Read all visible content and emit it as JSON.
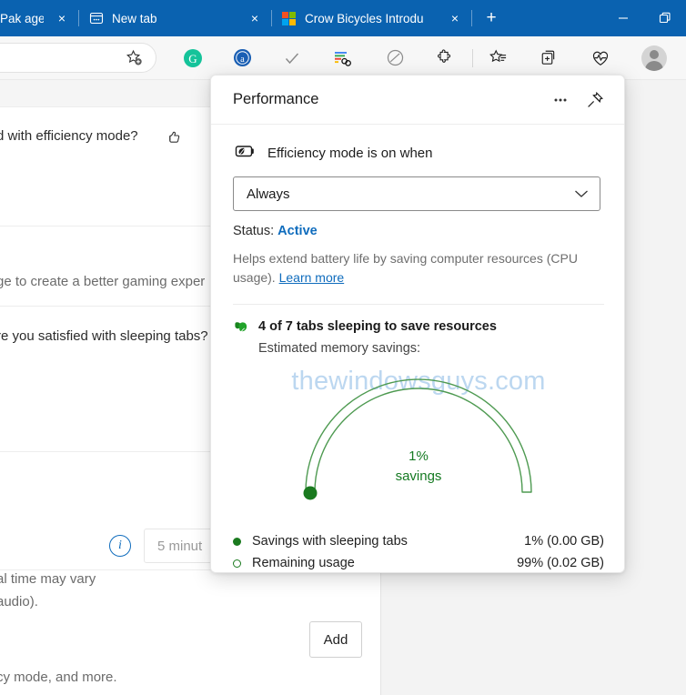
{
  "window": {
    "tabs": [
      {
        "title": "Pak agen",
        "favicon": "none",
        "close_label": "×"
      },
      {
        "title": "New tab",
        "favicon": "newtab-icon",
        "close_label": "×"
      },
      {
        "title": "Crow Bicycles Introdu",
        "favicon": "microsoft-logo",
        "close_label": "×"
      }
    ],
    "new_tab_button": "+",
    "controls": {
      "minimize": "—",
      "restore": "❐"
    }
  },
  "toolbar": {
    "icons": [
      "add-favorite-icon",
      "grammarly-icon",
      "amazon-assistant-icon",
      "checkmark-icon",
      "google-translate-link-icon",
      "adblock-icon",
      "extensions-puzzle-icon",
      "favorites-list-icon",
      "collections-add-icon",
      "browser-essentials-heart-icon",
      "profile-avatar"
    ]
  },
  "flyout": {
    "title": "Performance",
    "more_options": "⋯",
    "pin_icon": "pin-icon",
    "efficiency": {
      "icon": "battery-leaf-icon",
      "label": "Efficiency mode is on when",
      "dropdown_value": "Always",
      "dropdown_chevron": "⌄",
      "status_label": "Status: ",
      "status_value": "Active",
      "description": "Helps extend battery life by saving computer resources (CPU usage). ",
      "learn_more": "Learn more"
    },
    "sleeping": {
      "icon": "leaf-icon",
      "title": "4 of 7 tabs sleeping to save resources",
      "subtitle": "Estimated memory savings:",
      "gauge_center_value": "1%",
      "gauge_center_label": "savings",
      "watermark": "thewindowsguys.com",
      "legend": [
        {
          "marker": "filled",
          "label": "Savings with sleeping tabs",
          "value": "1% (0.00 GB)"
        },
        {
          "marker": "hollow",
          "label": "Remaining usage",
          "value": "99% (0.02 GB)"
        }
      ]
    }
  },
  "chart_data": {
    "type": "pie",
    "title": "Estimated memory savings",
    "subtype": "half-donut-gauge",
    "categories": [
      "Savings with sleeping tabs",
      "Remaining usage"
    ],
    "values": [
      1,
      99
    ],
    "value_labels": [
      "1% (0.00 GB)",
      "99% (0.02 GB)"
    ],
    "units": "percent",
    "absolute_gb": [
      0.0,
      0.02
    ],
    "center_label": "1% savings",
    "colors": {
      "savings": "#1a7a1f",
      "remaining": "#4e9a51"
    },
    "legend_position": "bottom",
    "grid": false
  },
  "page": {
    "texts": [
      {
        "value": "d with efficiency mode?"
      },
      {
        "value": "ge to create a better gaming exper"
      },
      {
        "value": "re you satisfied with sleeping tabs?"
      },
      {
        "value": "al time may vary"
      },
      {
        "value": "audio)."
      },
      {
        "value": "cy mode, and more."
      }
    ],
    "sleep_timer_placeholder": "5 minut",
    "add_button": "Add",
    "thumbs_up_icon": "thumbs-up-icon",
    "info_icon": "info-icon"
  },
  "colors": {
    "tabstrip_blue": "#0a62b0",
    "accent_blue": "#0f6cbd",
    "green": "#1a7a1f",
    "watermark_blue": "#bcd7f0"
  }
}
